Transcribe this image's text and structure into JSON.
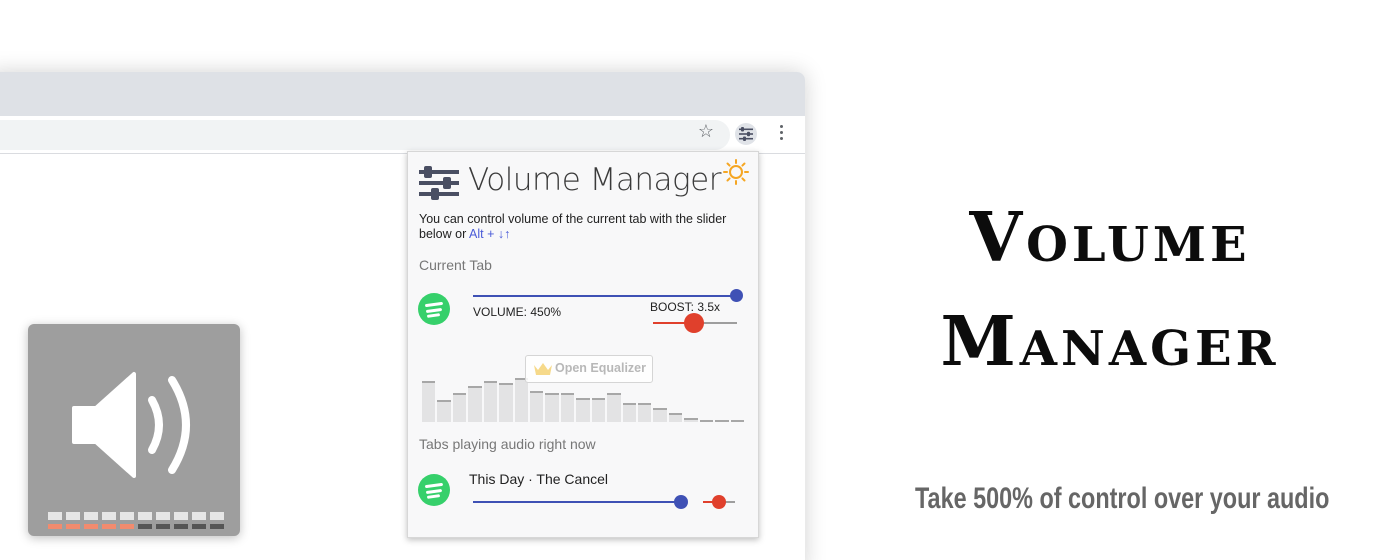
{
  "popup": {
    "title": "Volume Manager",
    "description": "You can control volume of the current tab with the slider below or",
    "shortcut": "Alt + ↓↑",
    "current_tab_label": "Current Tab",
    "volume_label": "VOLUME: 450%",
    "volume_level_percent": 100,
    "boost_label": "BOOST: 3.5x",
    "boost_level_fraction": 0.5,
    "equalizer_button_label": "Open Equalizer",
    "equalizer_bands": [
      0.82,
      0.45,
      0.58,
      0.72,
      0.82,
      0.78,
      0.88,
      0.62,
      0.58,
      0.58,
      0.48,
      0.48,
      0.58,
      0.38,
      0.38,
      0.28,
      0.18,
      0.08,
      0.04,
      0.04,
      0.04
    ],
    "tabs_playing_label": "Tabs playing audio right now",
    "tabs_playing": [
      {
        "title": "This Day · The Cancel",
        "volume_level_fraction": 0.8,
        "boost_level_fraction": 0.5
      }
    ]
  },
  "hero": {
    "title_line1": "Volume",
    "title_line2": "Manager",
    "tagline": "Take 500% of control over your audio"
  },
  "speaker_meter": {
    "segments_total": 10,
    "segments_active": 5
  },
  "colors": {
    "accent_blue": "#3f51b5",
    "boost_red": "#e0402c",
    "spotify_green": "#36d06b",
    "sun_orange": "#f5a623",
    "meter_active": "#f28b6e"
  }
}
